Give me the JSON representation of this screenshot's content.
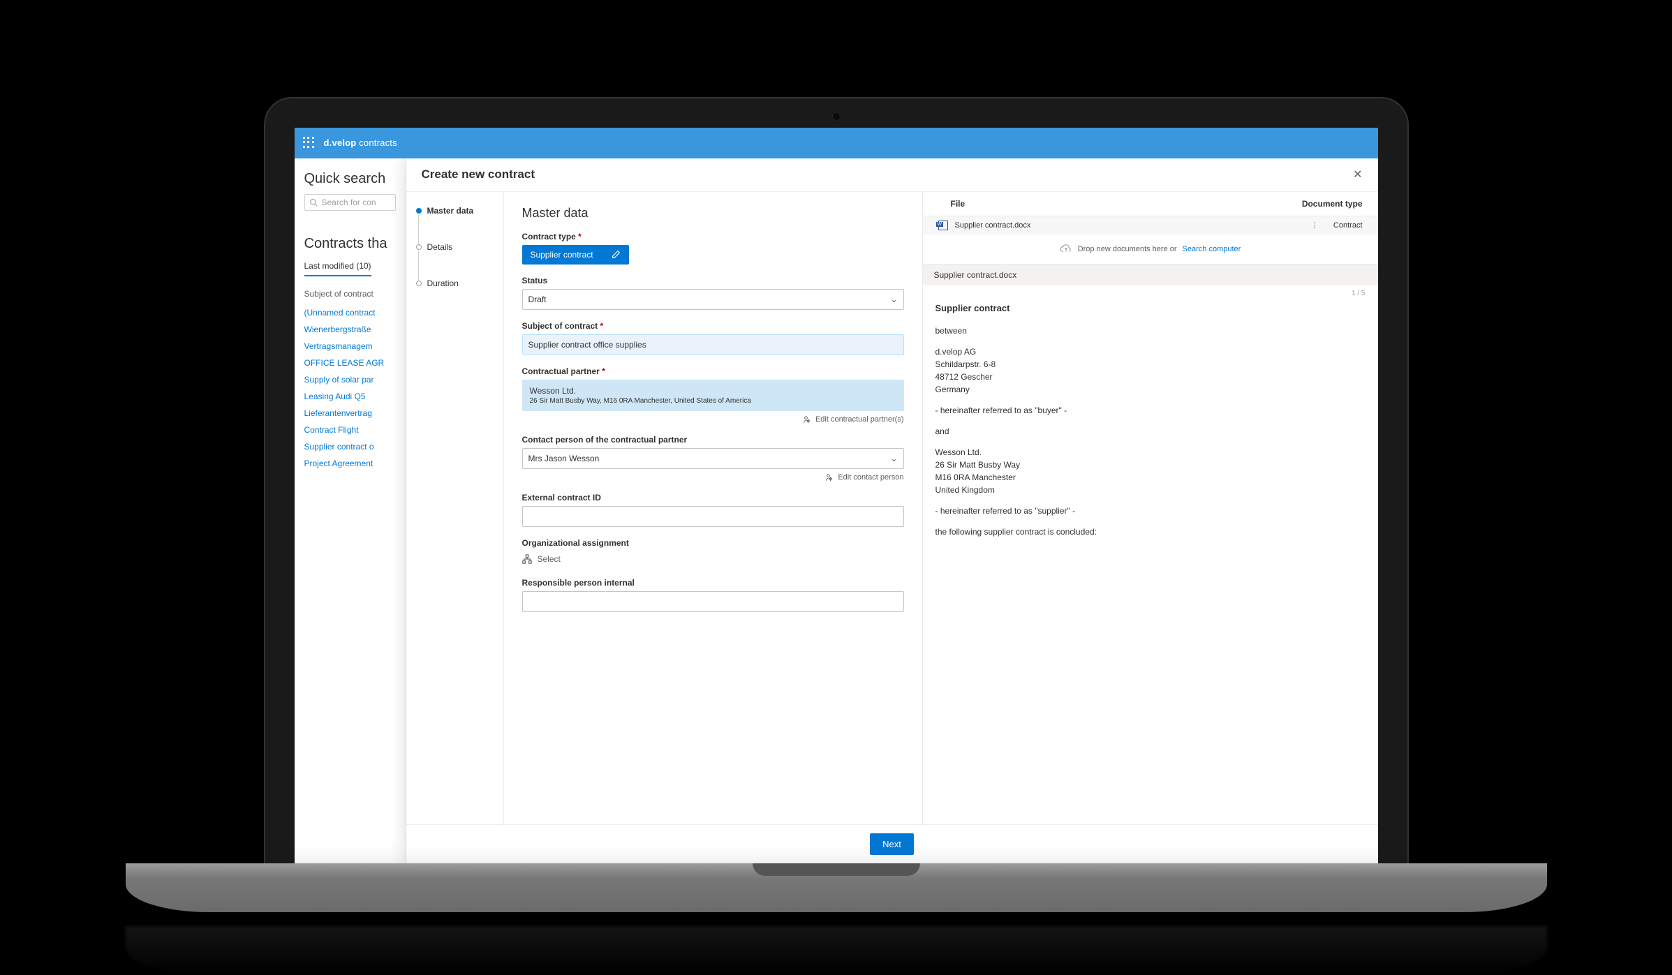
{
  "topbar": {
    "brand": "d.velop",
    "app": "contracts"
  },
  "sidebar": {
    "quick_search": "Quick search",
    "search_placeholder": "Search for con",
    "contracts_that": "Contracts tha",
    "tab_last_modified": "Last modified (10)",
    "group_label": "Subject of contract",
    "items": [
      "(Unnamed contract",
      "Wienerbergstraße",
      "Vertragsmanagem",
      "OFFICE LEASE AGR",
      "Supply of solar par",
      "Leasing Audi Q5",
      "Lieferantenvertrag",
      "Contract Flight",
      "Supplier contract o",
      "Project Agreement"
    ]
  },
  "panel": {
    "title": "Create new contract",
    "steps": [
      "Master data",
      "Details",
      "Duration"
    ],
    "next": "Next"
  },
  "form": {
    "section_title": "Master data",
    "contract_type_label": "Contract type",
    "contract_type_value": "Supplier contract",
    "status_label": "Status",
    "status_value": "Draft",
    "subject_label": "Subject of contract",
    "subject_value": "Supplier contract office supplies",
    "partner_label": "Contractual partner",
    "partner_name": "Wesson Ltd.",
    "partner_addr": "26 Sir Matt Busby Way, M16 0RA Manchester, United States of America",
    "edit_partner": "Edit contractual partner(s)",
    "contact_label": "Contact person of the contractual partner",
    "contact_value": "Mrs Jason Wesson",
    "edit_contact": "Edit contact person",
    "external_id_label": "External contract ID",
    "org_label": "Organizational assignment",
    "org_select": "Select",
    "responsible_label": "Responsible person internal"
  },
  "docs": {
    "col_file": "File",
    "col_type": "Document type",
    "file_name": "Supplier contract.docx",
    "file_type": "Contract",
    "drop_text": "Drop new documents here or ",
    "drop_link": "Search computer",
    "doc_bar": "Supplier contract.docx",
    "page_ind": "1 / 5",
    "preview_title": "Supplier contract",
    "body": {
      "between": "between",
      "buyer_1": "d.velop AG",
      "buyer_2": "Schildarpstr. 6-8",
      "buyer_3": "48712 Gescher",
      "buyer_4": "Germany",
      "buyer_ref": "- hereinafter referred to as \"buyer\" -",
      "and": "and",
      "supp_1": "Wesson Ltd.",
      "supp_2": "26 Sir Matt Busby Way",
      "supp_3": "M16 0RA Manchester",
      "supp_4": "United Kingdom",
      "supp_ref": "- hereinafter referred to as \"supplier\" -",
      "concluded": "the following supplier contract is concluded:"
    }
  }
}
